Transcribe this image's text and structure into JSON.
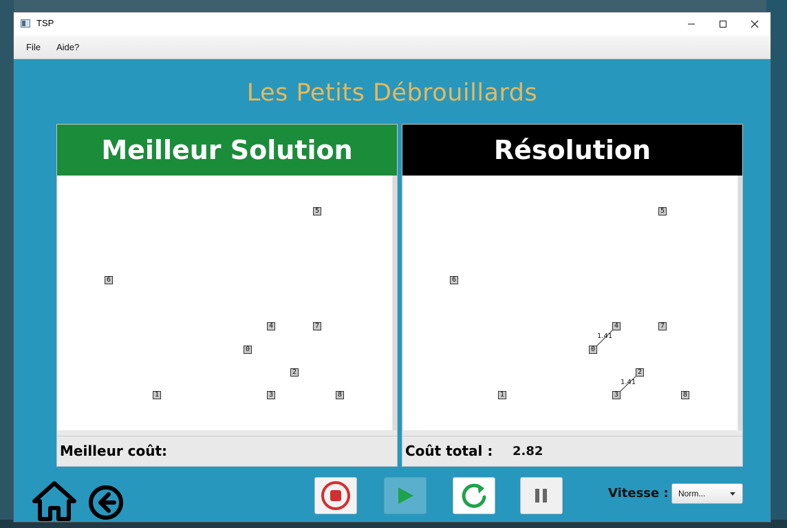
{
  "window": {
    "title": "TSP",
    "controls": [
      "minimize-icon",
      "maximize-icon",
      "close-icon"
    ]
  },
  "menu": {
    "items": [
      "File",
      "Aide?"
    ]
  },
  "app_title": "Les Petits Débrouillards",
  "best_panel": {
    "title": "Meilleur Solution",
    "header_color": "#1b8c3a",
    "footer_label": "Meilleur coût:",
    "footer_value": "",
    "nodes": [
      {
        "id": "0"
      },
      {
        "id": "1"
      },
      {
        "id": "2"
      },
      {
        "id": "3"
      },
      {
        "id": "4"
      },
      {
        "id": "5"
      },
      {
        "id": "6"
      },
      {
        "id": "7"
      },
      {
        "id": "8"
      }
    ],
    "edges": []
  },
  "resolution_panel": {
    "title": "Résolution",
    "header_color": "#000000",
    "footer_label": "Coût total :",
    "footer_value": "2.82",
    "nodes": [
      {
        "id": "0"
      },
      {
        "id": "1"
      },
      {
        "id": "2"
      },
      {
        "id": "3"
      },
      {
        "id": "4"
      },
      {
        "id": "5"
      },
      {
        "id": "6"
      },
      {
        "id": "7"
      },
      {
        "id": "8"
      }
    ],
    "edges": [
      {
        "from": "0",
        "to": "4",
        "label": "1.41"
      },
      {
        "from": "3",
        "to": "2",
        "label": "1.41"
      }
    ]
  },
  "controls": {
    "stop": "stop-icon",
    "play": "play-icon",
    "reset": "reset-icon",
    "pause": "pause-icon"
  },
  "speed": {
    "label": "Vitesse :",
    "value": "Norm..."
  },
  "nav": {
    "home": "home-icon",
    "back": "back-arrow-icon"
  },
  "colors": {
    "background": "#2797bd",
    "title": "#e8b85a",
    "stop_red": "#d32f2f",
    "play_green": "#1fa34a",
    "reset_green": "#1fa34a"
  }
}
